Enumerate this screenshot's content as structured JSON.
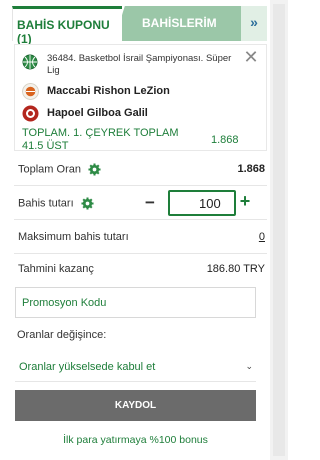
{
  "tabs": {
    "coupon_label": "BAHİS KUPONU (1)",
    "bets_label": "BAHİSLERİM",
    "expand_label": "»"
  },
  "bet": {
    "event_title": "36484. Basketbol İsrail Şampiyonası. Süper Lig",
    "home_team": "Maccabi Rishon LeZion",
    "away_team": "Hapoel Gilboa Galil",
    "market": "TOPLAM. 1. ÇEYREK TOPLAM 41.5 ÜST",
    "odd": "1.868",
    "close_label": "✕"
  },
  "summary": {
    "total_odds_label": "Toplam Oran",
    "total_odds_value": "1.868",
    "stake_label": "Bahis tutarı",
    "stake_value": "100",
    "minus_label": "−",
    "plus_label": "+",
    "max_stake_label": "Maksimum bahis tutarı",
    "max_stake_value": "0",
    "estimated_win_label": "Tahmini kazanç",
    "estimated_win_value": "186.80 TRY"
  },
  "promo": {
    "placeholder": "Promosyon Kodu"
  },
  "odds_change": {
    "label": "Oranlar değişince:",
    "selected": "Oranlar yükselsede kabul et"
  },
  "actions": {
    "register_label": "KAYDOL"
  },
  "bonus_text": "İlk para yatırmaya %100 bonus",
  "colors": {
    "brand_green": "#1e7e3a",
    "tab_inactive": "#9bc7a8",
    "button_gray": "#6b6b6b"
  },
  "icons": {
    "sport": "basketball-icon",
    "settings": "gear-icon",
    "close": "close-icon",
    "chevron": "chevron-down-icon"
  }
}
